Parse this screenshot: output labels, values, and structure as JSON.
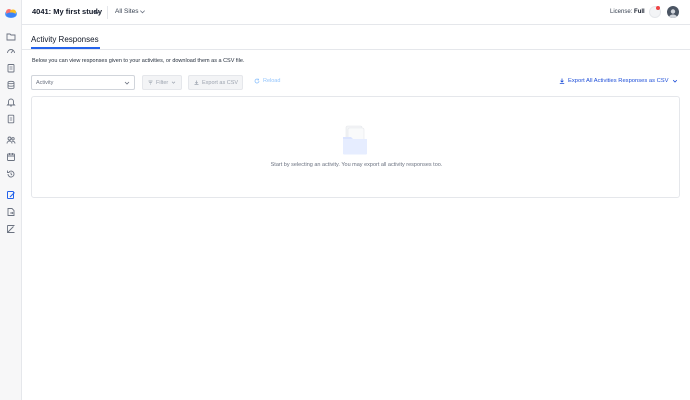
{
  "header": {
    "study_title": "4041: My first study",
    "sites_label": "All Sites",
    "license_label": "License:",
    "license_value": "Full"
  },
  "sidebar": {
    "items": [
      {
        "icon": "folder-icon"
      },
      {
        "icon": "dashboard-icon"
      },
      {
        "icon": "clipboard-icon"
      },
      {
        "icon": "database-icon"
      },
      {
        "icon": "bell-icon"
      },
      {
        "icon": "document-icon"
      },
      {
        "icon": "users-icon"
      },
      {
        "icon": "calendar-icon"
      },
      {
        "icon": "history-icon"
      },
      {
        "icon": "edit-form-icon",
        "active": true
      },
      {
        "icon": "file-export-icon"
      },
      {
        "icon": "pen-icon"
      }
    ]
  },
  "main": {
    "tab_label": "Activity Responses",
    "description": "Below you can view responses given to your activities, or download them as a CSV file.",
    "activity_placeholder": "Activity",
    "filter_label": "Filter",
    "export_csv_label": "Export as CSV",
    "reload_label": "Reload",
    "export_all_label": "Export All Activities Responses as CSV",
    "empty_message": "Start by selecting an activity. You may export all activity responses too."
  },
  "colors": {
    "accent": "#2563eb",
    "link": "#1d4ed8",
    "disabled_text": "#9ca3af",
    "notification": "#ef4444"
  }
}
